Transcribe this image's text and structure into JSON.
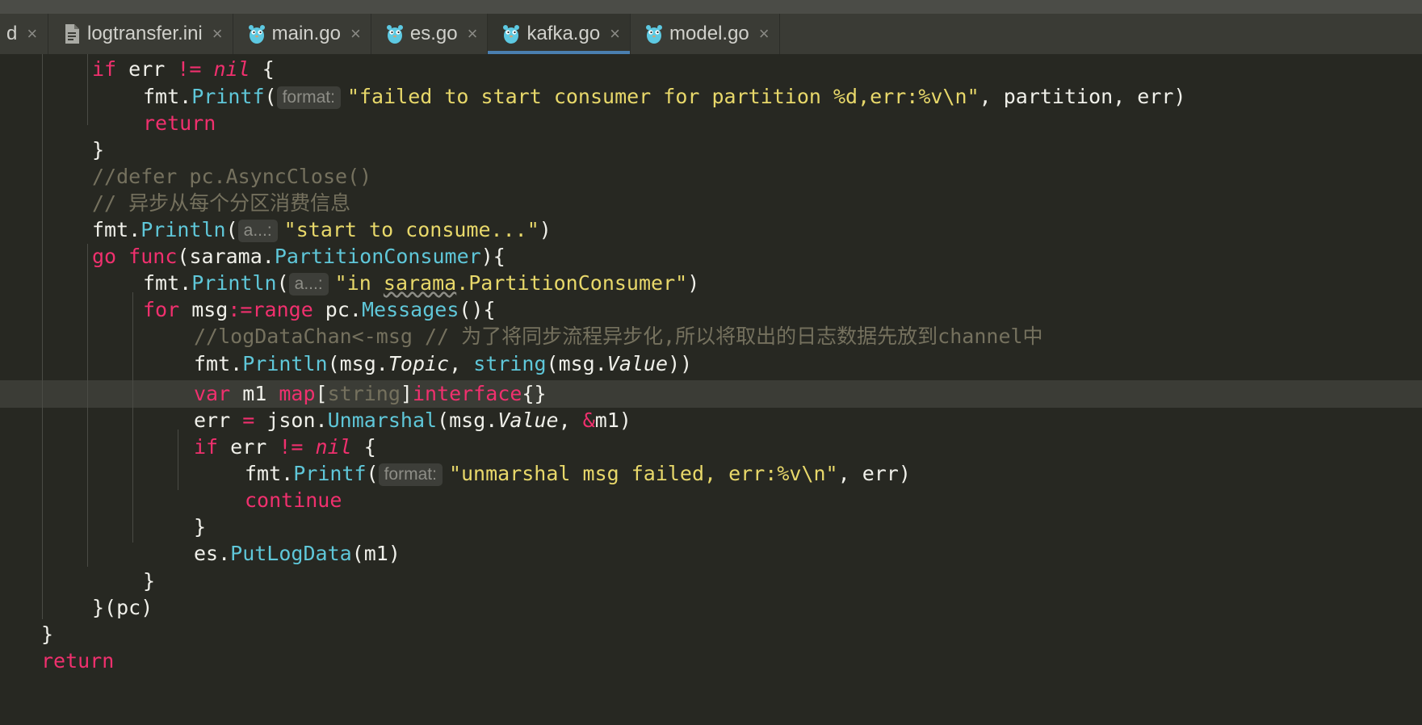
{
  "tabs": [
    {
      "label": "d",
      "icon": "none",
      "active": false
    },
    {
      "label": "logtransfer.ini",
      "icon": "ini-file-icon",
      "active": false
    },
    {
      "label": "main.go",
      "icon": "go-file-icon",
      "active": false
    },
    {
      "label": "es.go",
      "icon": "go-file-icon",
      "active": false
    },
    {
      "label": "kafka.go",
      "icon": "go-file-icon",
      "active": true
    },
    {
      "label": "model.go",
      "icon": "go-file-icon",
      "active": false
    }
  ],
  "close_glyph": "×",
  "colors": {
    "background": "#272822",
    "keyword": "#f0306e",
    "function": "#5fc7d9",
    "string": "#e8d86a",
    "comment": "#75715e",
    "active_tab_indicator": "#4a7fb0"
  },
  "code": {
    "l1": {
      "kw": "if",
      "a": " err ",
      "op": "!=",
      "b": " ",
      "nil": "nil",
      "c": " {"
    },
    "l2": {
      "pkg": "fmt.",
      "fn": "Printf",
      "paren": "(",
      "hint": "format:",
      "str": "\"failed to start consumer for partition %d,err:%v\\n\"",
      "rest": ", partition, err)"
    },
    "l3": {
      "kw": "return"
    },
    "l4": {
      "text": "}"
    },
    "l5": {
      "comment": "//defer pc.AsyncClose()"
    },
    "l6": {
      "comment": "// 异步从每个分区消费信息"
    },
    "l7": {
      "pkg": "fmt.",
      "fn": "Println",
      "paren": "(",
      "hint": "a...:",
      "str": "\"start to consume...\"",
      "rest": ")"
    },
    "l8": {
      "kw1": "go",
      "sp": " ",
      "kw2": "func",
      "a": "(sarama.",
      "type": "PartitionConsumer",
      "b": "){"
    },
    "l9": {
      "pkg": "fmt.",
      "fn": "Println",
      "paren": "(",
      "hint": "a...:",
      "str1": "\"in ",
      "str_sq": "sarama",
      "str2": ".PartitionConsumer\"",
      "rest": ")"
    },
    "l10": {
      "kw": "for",
      "a": " msg",
      "op": ":=",
      "kw2": "range",
      "b": " pc.",
      "fn": "Messages",
      "c": "(){"
    },
    "l11": {
      "comment": "//logDataChan<-msg // 为了将同步流程异步化,所以将取出的日志数据先放到channel中"
    },
    "l12": {
      "pkg": "fmt.",
      "fn": "Println",
      "a": "(msg.",
      "field": "Topic",
      "b": ", ",
      "fn2": "string",
      "c": "(msg.",
      "field2": "Value",
      "d": "))"
    },
    "l13": {
      "kw": "var",
      "a": " m1 ",
      "kw2": "map",
      "b": "[",
      "type": "string",
      "c": "]",
      "kw3": "interface",
      "d": "{}"
    },
    "l14": {
      "a": "err ",
      "op": "=",
      "b": " json.",
      "fn": "Unmarshal",
      "c": "(msg.",
      "field": "Value",
      "d": ", ",
      "amp": "&",
      "e": "m1)"
    },
    "l15": {
      "kw": "if",
      "a": " err ",
      "op": "!=",
      "b": " ",
      "nil": "nil",
      "c": " {"
    },
    "l16": {
      "pkg": "fmt.",
      "fn": "Printf",
      "paren": "(",
      "hint": "format:",
      "str": "\"unmarshal msg failed, err:%v\\n\"",
      "rest": ", err)"
    },
    "l17": {
      "kw": "continue"
    },
    "l18": {
      "text": "}"
    },
    "l19": {
      "a": "es.",
      "fn": "PutLogData",
      "b": "(m1)"
    },
    "l20": {
      "text": "}"
    },
    "l21": {
      "text": "}(pc)"
    },
    "l22": {
      "text": "}"
    },
    "l23": {
      "kw": "return"
    }
  }
}
